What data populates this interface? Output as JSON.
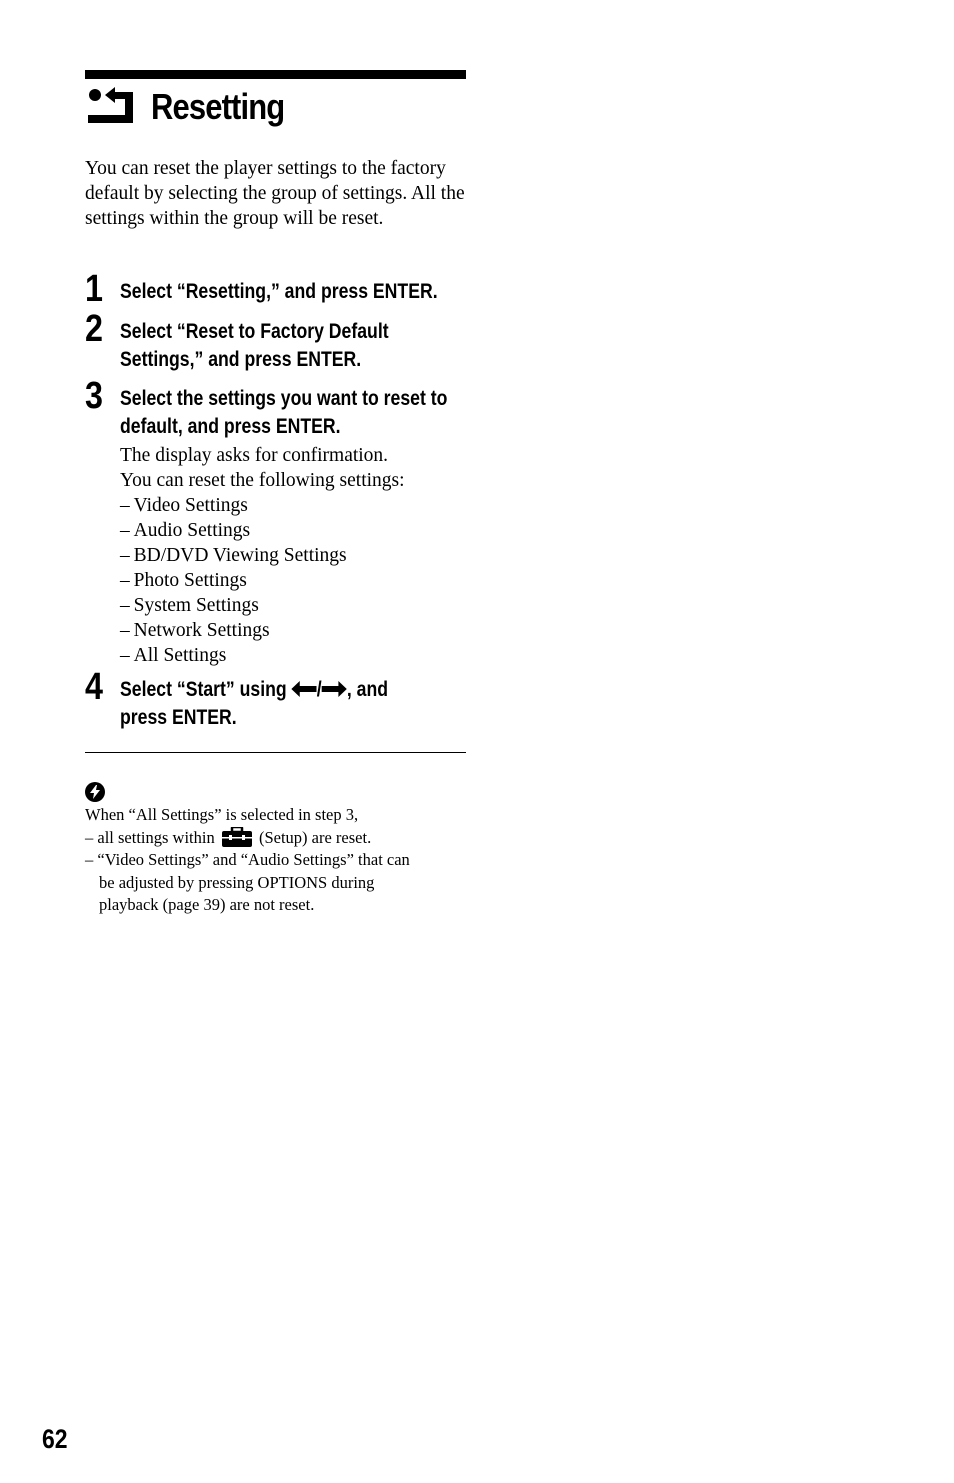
{
  "header": {
    "title": "Resetting",
    "icon": "reset-arrow-icon"
  },
  "intro": "You can reset the player settings to the factory default by selecting the group of settings. All the settings within the group will be reset.",
  "steps": [
    {
      "number": "1",
      "lines": [
        "Select “Resetting,” and press ENTER."
      ]
    },
    {
      "number": "2",
      "lines": [
        "Select “Reset to Factory Default",
        "Settings,” and press ENTER."
      ]
    },
    {
      "number": "3",
      "lines": [
        "Select the settings you want to reset to",
        "default, and press ENTER."
      ],
      "body": [
        "The display asks for confirmation.",
        "You can reset the following settings:"
      ],
      "options": [
        "– Video Settings",
        "– Audio Settings",
        "– BD/DVD Viewing Settings",
        "– Photo Settings",
        "– System Settings",
        "– Network Settings",
        "– All Settings"
      ]
    },
    {
      "number": "4",
      "line1_before": "Select “Start” using ",
      "line1_sep": "/",
      "line1_after": ", and",
      "line2": "press ENTER.",
      "arrows": [
        "left-arrow-icon",
        "right-arrow-icon"
      ]
    }
  ],
  "notes": {
    "icon": "hint-icon",
    "line1": "When “All Settings” is selected in step 3,",
    "line2_before": "– all settings within ",
    "line2_icon": "setup-toolbox-icon",
    "line2_after": " (Setup) are reset.",
    "line3": "– “Video Settings” and “Audio Settings” that can",
    "line4": "be adjusted by pressing OPTIONS during",
    "line5": "playback (page 39) are not reset."
  },
  "footer": {
    "page_number": "62"
  }
}
